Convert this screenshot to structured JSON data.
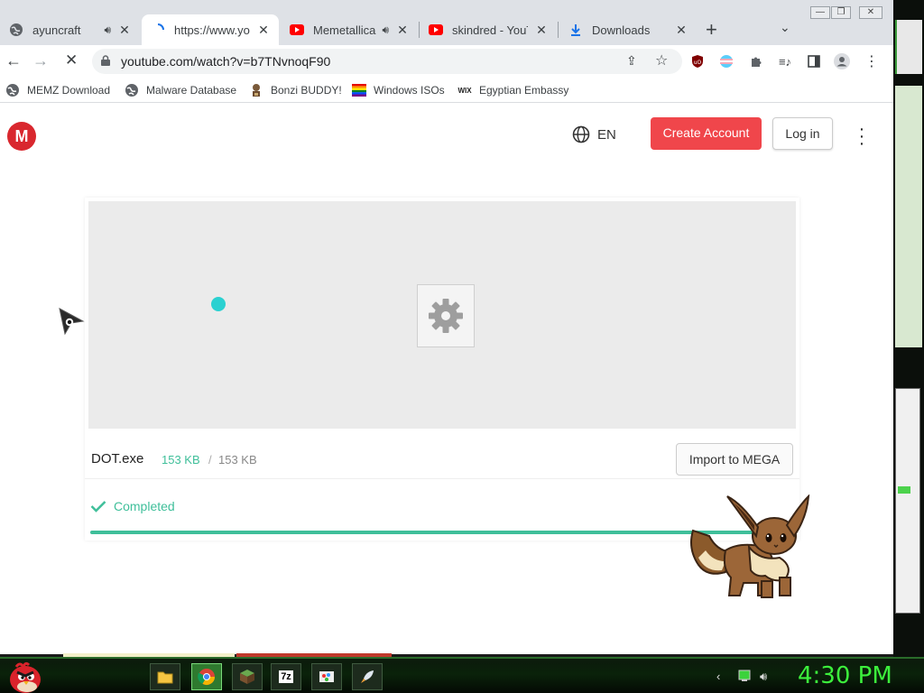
{
  "tabs": [
    {
      "title": "ayuncraft",
      "icon": "globe-icon",
      "audio": true
    },
    {
      "title": "https://www.you",
      "icon": "loading-spinner-icon",
      "audio": false,
      "active": true
    },
    {
      "title": "Memetallica",
      "icon": "youtube-icon",
      "audio": true
    },
    {
      "title": "skindred - YouTu",
      "icon": "youtube-icon",
      "audio": false
    },
    {
      "title": "Downloads",
      "icon": "download-icon",
      "audio": false
    }
  ],
  "toolbar": {
    "url": "youtube.com/watch?v=b7TNvnoqF90"
  },
  "bookmarks": [
    {
      "label": "MEMZ Download",
      "icon": "globe-icon"
    },
    {
      "label": "Malware Database",
      "icon": "globe-icon"
    },
    {
      "label": "Bonzi BUDDY!",
      "icon": "bonzi-icon"
    },
    {
      "label": "Windows ISOs",
      "icon": "rainbow-flag-icon"
    },
    {
      "label": "Egyptian Embassy",
      "icon": "wix-icon"
    }
  ],
  "mega": {
    "logo_letter": "M",
    "language": "EN",
    "create_account": "Create Account",
    "login": "Log in",
    "file_name": "DOT.exe",
    "size_downloaded": "153 KB",
    "size_separator": "/",
    "size_total": "153 KB",
    "import_button": "Import to MEGA",
    "status": "Completed",
    "progress": 1.0,
    "accent_color": "#f0464b",
    "success_color": "#3fbf9a"
  },
  "taskbar": {
    "clock": "4:30 PM",
    "apps": [
      "file-explorer-icon",
      "chrome-icon",
      "minecraft-icon",
      "7zip-icon",
      "paint-icon",
      "rocket-icon"
    ]
  }
}
